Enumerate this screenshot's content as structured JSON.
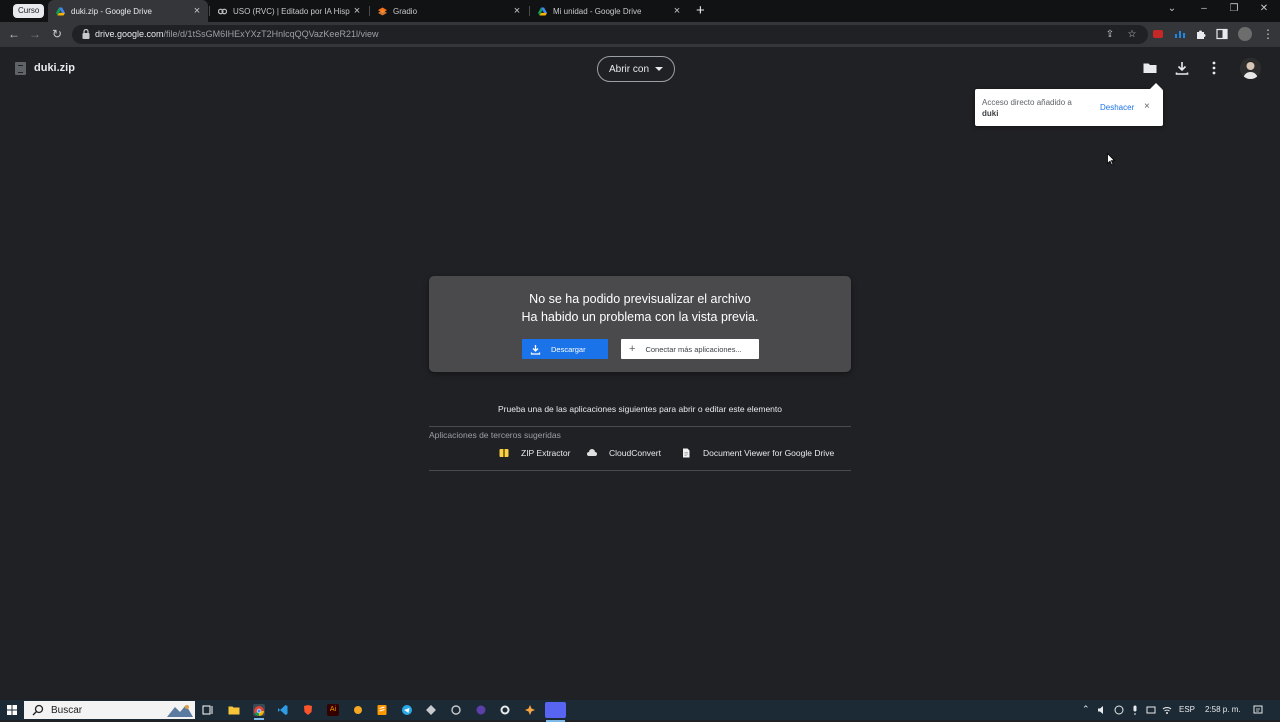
{
  "browser": {
    "group_label": "Curso",
    "tabs": [
      {
        "title": "duki.zip - Google Drive",
        "active": true
      },
      {
        "title": "USO (RVC) | Editado por IA Hispa",
        "active": false
      },
      {
        "title": "Gradio",
        "active": false
      },
      {
        "title": "Mi unidad - Google Drive",
        "active": false
      }
    ],
    "close_glyph": "×",
    "new_tab_glyph": "+",
    "url_host": "drive.google.com",
    "url_path": "/file/d/1tSsGM6IHExYXzT2HnlcqQQVazKeeR21l/view"
  },
  "viewer": {
    "file_name": "duki.zip",
    "open_with_label": "Abrir con",
    "header_icons": [
      "folder-icon",
      "download-icon",
      "more-vert-icon"
    ]
  },
  "toast": {
    "message": "Acceso directo añadido a",
    "target": "duki",
    "undo_label": "Deshacer",
    "close_glyph": "×"
  },
  "preview_error": {
    "line1": "No se ha podido previsualizar el archivo",
    "line2": "Ha habido un problema con la vista previa.",
    "download_label": "Descargar",
    "connect_label": "Conectar más aplicaciones...",
    "connect_glyph": "+"
  },
  "suggestions": {
    "try_text": "Prueba una de las aplicaciones siguientes para abrir o editar este elemento",
    "third_party_label": "Aplicaciones de terceros sugeridas",
    "apps": [
      {
        "name": "ZIP Extractor",
        "icon": "zip-extractor-icon"
      },
      {
        "name": "CloudConvert",
        "icon": "cloudconvert-icon"
      },
      {
        "name": "Document Viewer for Google Drive",
        "icon": "document-viewer-icon"
      }
    ]
  },
  "taskbar": {
    "search_placeholder": "Buscar",
    "language": "ESP",
    "time": "2:58 p. m."
  },
  "colors": {
    "accent": "#1a73e8",
    "background": "#202124",
    "card": "#4a4a4d"
  }
}
